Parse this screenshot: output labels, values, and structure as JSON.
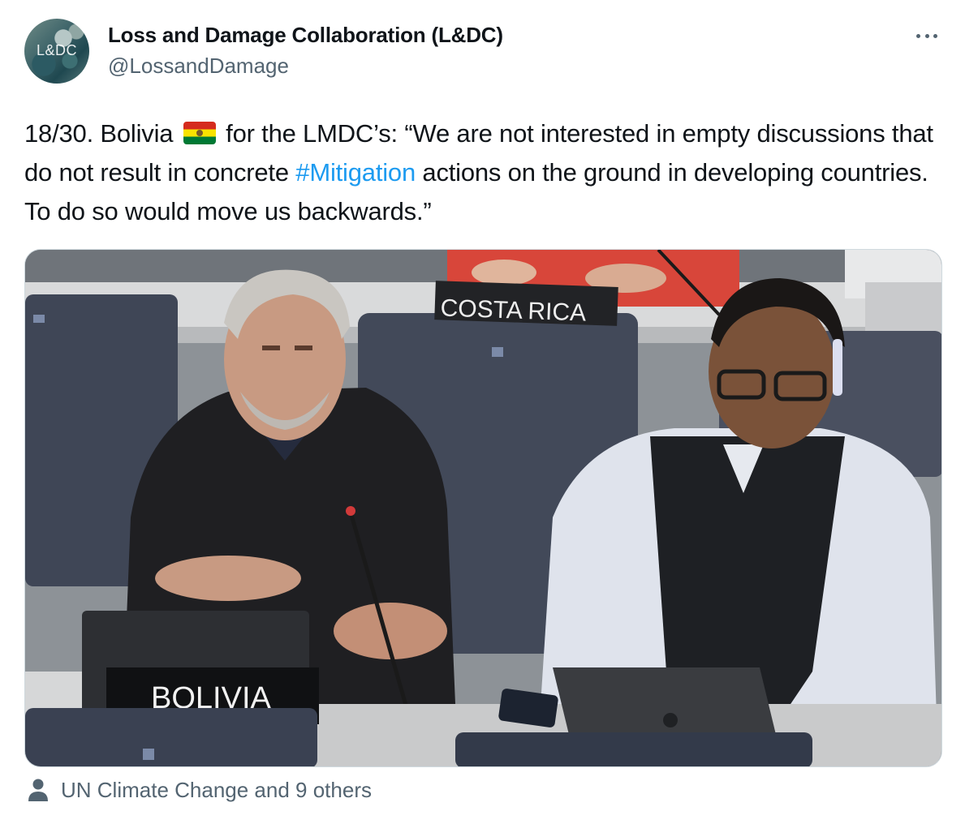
{
  "author": {
    "avatar_text": "L&DC",
    "display_name": "Loss and Damage Collaboration (L&DC)",
    "handle": "@LossandDamage"
  },
  "tweet": {
    "text_part1": "18/30. Bolivia",
    "flag_emoji": "bolivia-flag",
    "text_part2": " for the LMDC’s: “We are not interested in empty discussions that do not result in concrete ",
    "hashtag": "#Mitigation",
    "text_part3": " actions on the ground in developing countries. To do so would move us backwards.”"
  },
  "media": {
    "nameplate_front": "BOLIVIA",
    "nameplate_back": "COSTA RICA"
  },
  "footer": {
    "tagged_text": "UN Climate Change and 9 others"
  },
  "colors": {
    "text": "#0f1419",
    "secondary": "#536471",
    "link": "#1d9bf0",
    "border": "#cfd9de"
  }
}
